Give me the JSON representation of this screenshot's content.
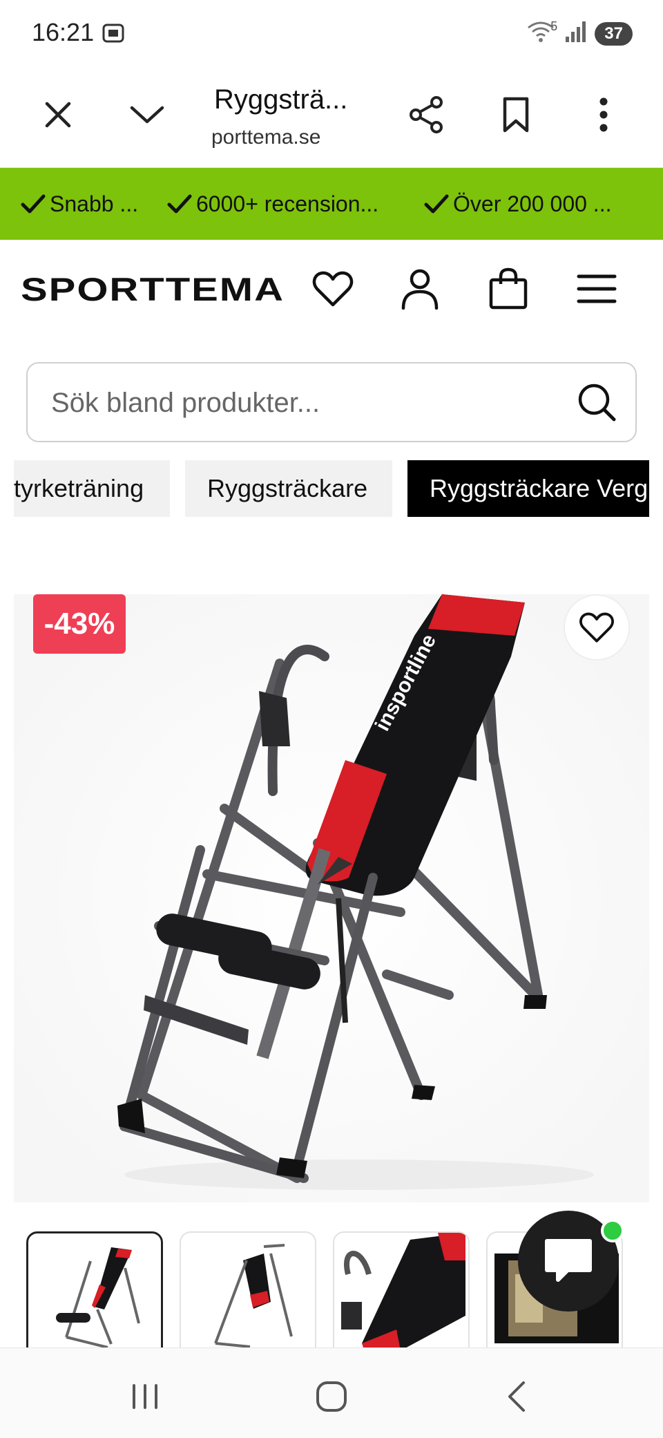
{
  "status_bar": {
    "time": "16:21",
    "wifi_badge": "5",
    "battery": "37"
  },
  "browser": {
    "title": "Ryggsträ...",
    "url": "porttema.se"
  },
  "usp": [
    {
      "text": "Snabb ..."
    },
    {
      "text": "6000+ recension..."
    },
    {
      "text": "Över 200 000 ..."
    }
  ],
  "header": {
    "logo_text": "SPORTTEMA"
  },
  "search": {
    "placeholder": "Sök bland produkter..."
  },
  "breadcrumbs": [
    {
      "label": "tyrketräning"
    },
    {
      "label": "Ryggsträckare"
    },
    {
      "label": "Ryggsträckare Verg"
    }
  ],
  "product": {
    "discount": "-43%",
    "brand_print": "insportline"
  },
  "colors": {
    "accent_green": "#7dc20b",
    "discount_red": "#ef3f55",
    "bench_red": "#e51c23"
  },
  "icons": [
    "close-icon",
    "chevron-down-icon",
    "share-icon",
    "bookmark-icon",
    "more-vert-icon",
    "heart-icon",
    "user-icon",
    "bag-icon",
    "menu-icon",
    "search-icon",
    "chat-icon"
  ]
}
